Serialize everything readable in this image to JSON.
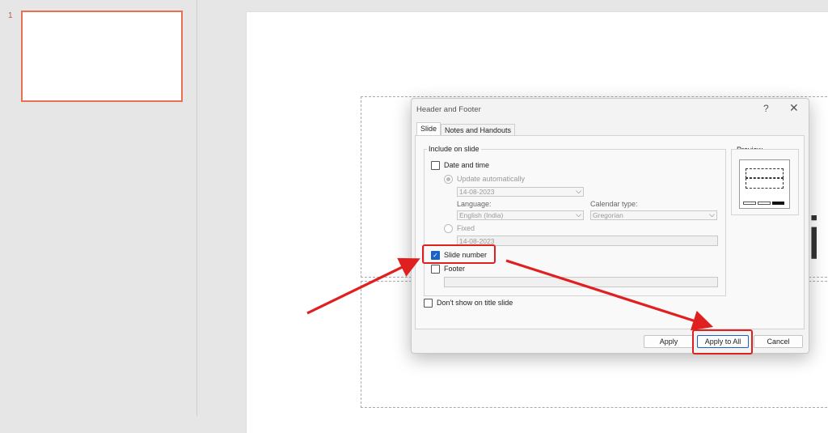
{
  "thumbnails": [
    {
      "number": "1"
    }
  ],
  "slide": {
    "partial_text": "ti"
  },
  "dialog": {
    "title": "Header and Footer",
    "help": "?",
    "close": "✕",
    "tabs": [
      {
        "label": "Slide"
      },
      {
        "label": "Notes and Handouts"
      }
    ],
    "include_group": "Include on slide",
    "date_time": {
      "label": "Date and time",
      "checked": false,
      "update_auto_label": "Update automatically",
      "date_value": "14-08-2023",
      "language_label": "Language:",
      "language_value": "English (India)",
      "calendar_label": "Calendar type:",
      "calendar_value": "Gregorian",
      "fixed_label": "Fixed",
      "fixed_value": "14-08-2023"
    },
    "slide_number": {
      "label": "Slide number",
      "checked": true
    },
    "footer": {
      "label": "Footer",
      "checked": false,
      "value": ""
    },
    "dont_show_title": {
      "label": "Don't show on title slide",
      "checked": false
    },
    "preview_label": "Preview",
    "buttons": {
      "apply": "Apply",
      "apply_all": "Apply to All",
      "cancel": "Cancel"
    }
  },
  "colors": {
    "highlight": "#e02020",
    "accent": "#1a63c4",
    "thumb_border": "#e87050"
  }
}
